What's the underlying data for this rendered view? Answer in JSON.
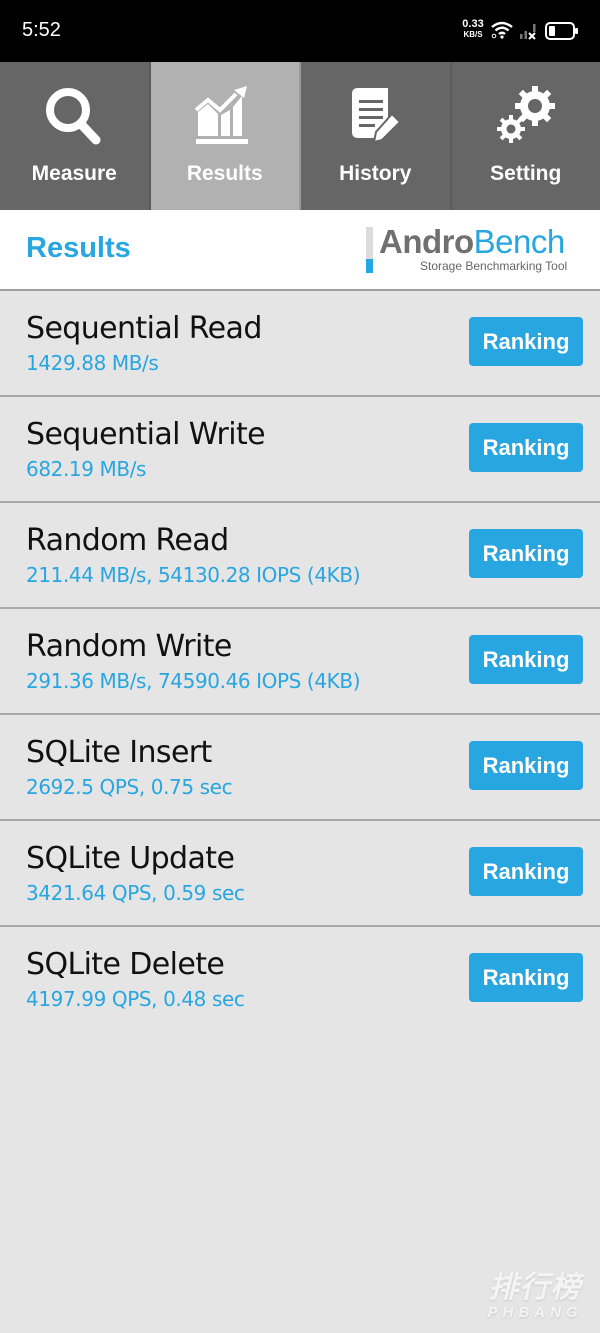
{
  "status_bar": {
    "time": "5:52",
    "net_speed_value": "0.33",
    "net_speed_unit": "KB/S",
    "icons": [
      "wifi-icon",
      "signal-no-service-icon",
      "battery-icon"
    ]
  },
  "tabs": [
    {
      "label": "Measure",
      "icon": "magnifier-icon",
      "active": false
    },
    {
      "label": "Results",
      "icon": "chart-trend-icon",
      "active": true
    },
    {
      "label": "History",
      "icon": "document-pencil-icon",
      "active": false
    },
    {
      "label": "Setting",
      "icon": "gears-icon",
      "active": false
    }
  ],
  "header": {
    "title": "Results",
    "logo_part1": "Andro",
    "logo_part2": "Bench",
    "logo_tagline": "Storage Benchmarking Tool"
  },
  "colors": {
    "accent": "#27a6e1",
    "tab_bg": "#666666",
    "tab_active_bg": "#b1b1b1",
    "list_bg": "#e5e5e5"
  },
  "results": [
    {
      "name": "Sequential Read",
      "value": "1429.88 MB/s",
      "button": "Ranking"
    },
    {
      "name": "Sequential Write",
      "value": "682.19 MB/s",
      "button": "Ranking"
    },
    {
      "name": "Random Read",
      "value": "211.44 MB/s, 54130.28 IOPS (4KB)",
      "button": "Ranking"
    },
    {
      "name": "Random Write",
      "value": "291.36 MB/s, 74590.46 IOPS (4KB)",
      "button": "Ranking"
    },
    {
      "name": "SQLite Insert",
      "value": "2692.5 QPS, 0.75 sec",
      "button": "Ranking"
    },
    {
      "name": "SQLite Update",
      "value": "3421.64 QPS, 0.59 sec",
      "button": "Ranking"
    },
    {
      "name": "SQLite Delete",
      "value": "4197.99 QPS, 0.48 sec",
      "button": "Ranking"
    }
  ],
  "watermark": {
    "cn": "排行榜",
    "en": "PHBANG"
  }
}
